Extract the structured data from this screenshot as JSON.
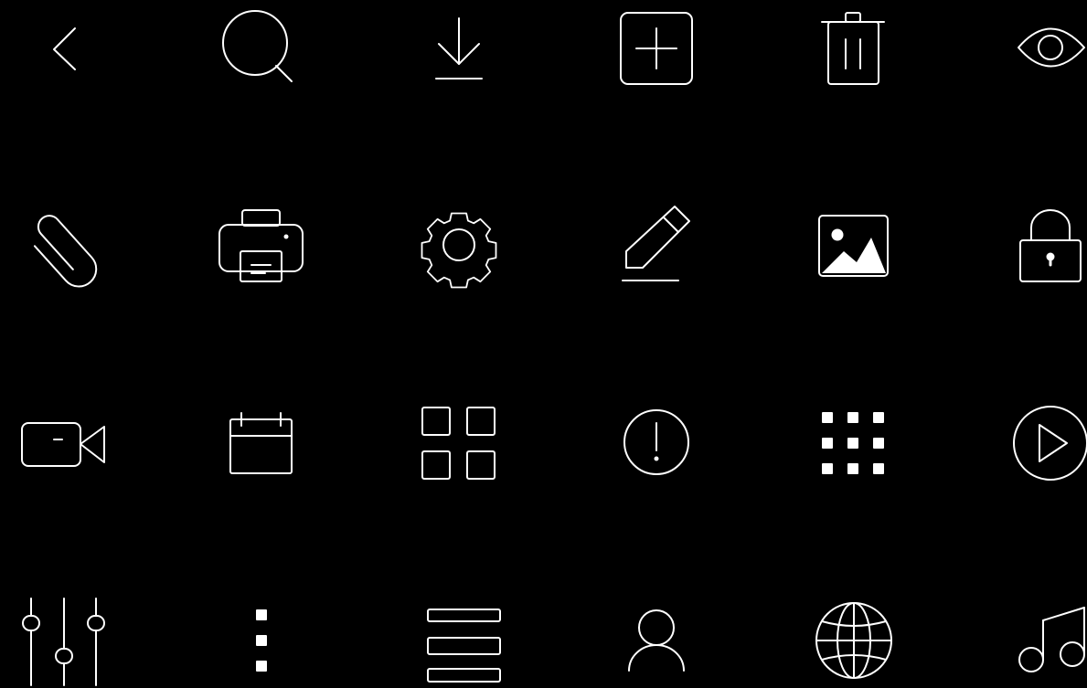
{
  "background_color": "#000000",
  "stroke_color": "#ffffff",
  "icons": [
    {
      "name": "chevron-left-icon"
    },
    {
      "name": "search-icon"
    },
    {
      "name": "download-icon"
    },
    {
      "name": "add-square-icon"
    },
    {
      "name": "trash-icon"
    },
    {
      "name": "eye-icon"
    },
    {
      "name": "paperclip-icon"
    },
    {
      "name": "printer-icon"
    },
    {
      "name": "gear-icon"
    },
    {
      "name": "pencil-icon"
    },
    {
      "name": "image-icon"
    },
    {
      "name": "lock-icon"
    },
    {
      "name": "video-camera-icon"
    },
    {
      "name": "calendar-icon"
    },
    {
      "name": "grid-2x2-icon"
    },
    {
      "name": "alert-circle-icon"
    },
    {
      "name": "grid-dots-3x3-icon"
    },
    {
      "name": "play-circle-icon"
    },
    {
      "name": "sliders-icon"
    },
    {
      "name": "more-vertical-icon"
    },
    {
      "name": "menu-list-icon"
    },
    {
      "name": "user-icon"
    },
    {
      "name": "globe-icon"
    },
    {
      "name": "music-note-icon"
    }
  ]
}
